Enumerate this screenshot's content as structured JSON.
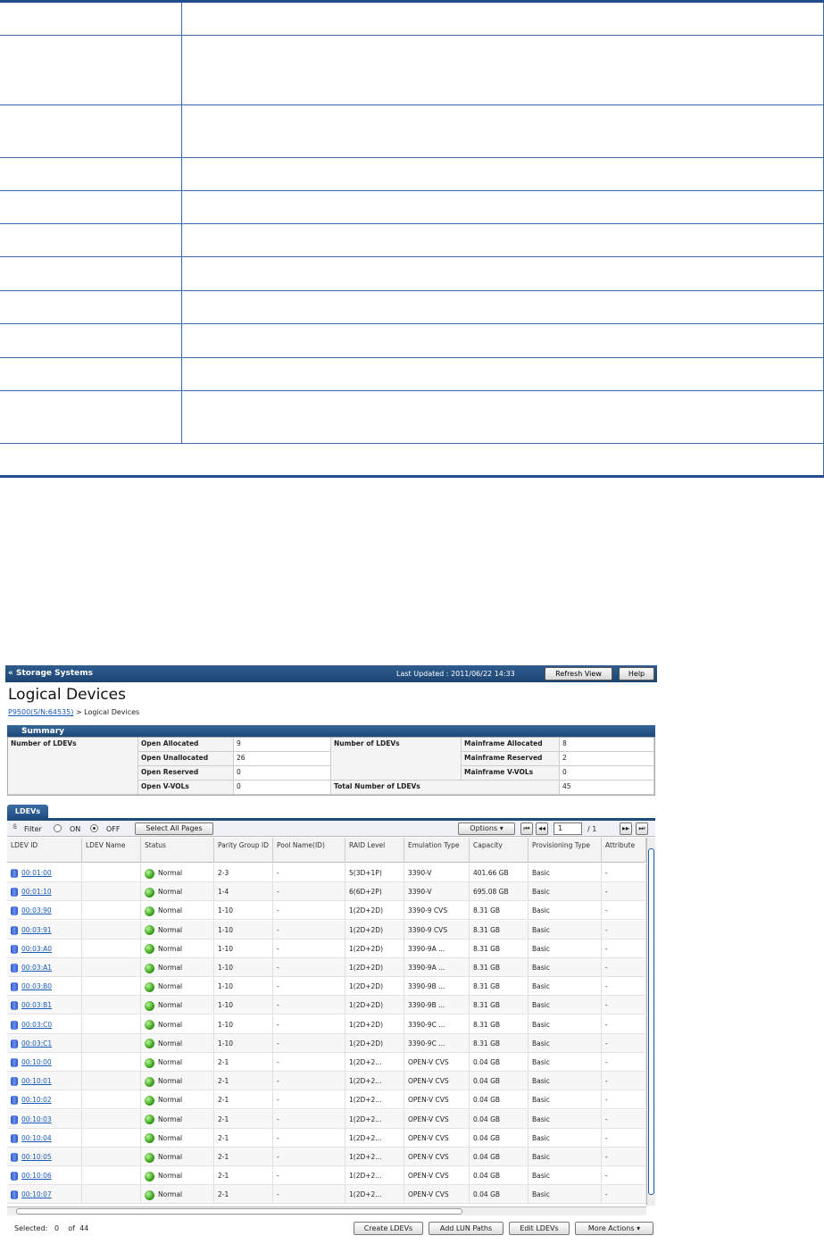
{
  "top_table": {
    "row_count": 12
  },
  "app": {
    "nav_title": "Storage Systems",
    "last_updated_label": "Last Updated : 2011/06/22 14:33",
    "refresh_button": "Refresh View",
    "help_button": "Help",
    "page_title": "Logical Devices",
    "breadcrumb_link": "P9500(S/N:64535)",
    "breadcrumb_current": "> Logical Devices"
  },
  "summary": {
    "title": "Summary",
    "open_label": "Number of LDEVs",
    "open_items": [
      {
        "label": "Open Allocated",
        "value": "9"
      },
      {
        "label": "Open Unallocated",
        "value": "26"
      },
      {
        "label": "Open Reserved",
        "value": "0"
      },
      {
        "label": "Open V-VOLs",
        "value": "0"
      }
    ],
    "mf_label": "Number of LDEVs",
    "mf_items": [
      {
        "label": "Mainframe Allocated",
        "value": "8"
      },
      {
        "label": "Mainframe Reserved",
        "value": "2"
      },
      {
        "label": "Mainframe V-VOLs",
        "value": "0"
      }
    ],
    "total_label": "Total Number of LDEVs",
    "total_value": "45"
  },
  "ldevs_tab": "LDEVs",
  "filter": {
    "label": "Filter",
    "on": "ON",
    "off": "OFF",
    "select_all": "Select All Pages",
    "options": "Options",
    "page": "1",
    "page_total": "/ 1"
  },
  "columns": [
    "LDEV ID",
    "LDEV Name",
    "Status",
    "Parity Group ID",
    "Pool Name(ID)",
    "RAID Level",
    "Emulation Type",
    "Capacity",
    "Provisioning Type",
    "Attribute"
  ],
  "rows": [
    [
      "00:01:00",
      "",
      "Normal",
      "2-3",
      "-",
      "5(3D+1P)",
      "3390-V",
      "401.66 GB",
      "Basic",
      "-"
    ],
    [
      "00:01:10",
      "",
      "Normal",
      "1-4",
      "-",
      "6(6D+2P)",
      "3390-V",
      "695.08 GB",
      "Basic",
      "-"
    ],
    [
      "00:03:90",
      "",
      "Normal",
      "1-10",
      "-",
      "1(2D+2D)",
      "3390-9 CVS",
      "8.31 GB",
      "Basic",
      "-"
    ],
    [
      "00:03:91",
      "",
      "Normal",
      "1-10",
      "-",
      "1(2D+2D)",
      "3390-9 CVS",
      "8.31 GB",
      "Basic",
      "-"
    ],
    [
      "00:03:A0",
      "",
      "Normal",
      "1-10",
      "-",
      "1(2D+2D)",
      "3390-9A ...",
      "8.31 GB",
      "Basic",
      "-"
    ],
    [
      "00:03:A1",
      "",
      "Normal",
      "1-10",
      "-",
      "1(2D+2D)",
      "3390-9A ...",
      "8.31 GB",
      "Basic",
      "-"
    ],
    [
      "00:03:B0",
      "",
      "Normal",
      "1-10",
      "-",
      "1(2D+2D)",
      "3390-9B ...",
      "8.31 GB",
      "Basic",
      "-"
    ],
    [
      "00:03:B1",
      "",
      "Normal",
      "1-10",
      "-",
      "1(2D+2D)",
      "3390-9B ...",
      "8.31 GB",
      "Basic",
      "-"
    ],
    [
      "00:03:C0",
      "",
      "Normal",
      "1-10",
      "-",
      "1(2D+2D)",
      "3390-9C ...",
      "8.31 GB",
      "Basic",
      "-"
    ],
    [
      "00:03:C1",
      "",
      "Normal",
      "1-10",
      "-",
      "1(2D+2D)",
      "3390-9C ...",
      "8.31 GB",
      "Basic",
      "-"
    ],
    [
      "00:10:00",
      "",
      "Normal",
      "2-1",
      "-",
      "1(2D+2...",
      "OPEN-V CVS",
      "0.04 GB",
      "Basic",
      "-"
    ],
    [
      "00:10:01",
      "",
      "Normal",
      "2-1",
      "-",
      "1(2D+2...",
      "OPEN-V CVS",
      "0.04 GB",
      "Basic",
      "-"
    ],
    [
      "00:10:02",
      "",
      "Normal",
      "2-1",
      "-",
      "1(2D+2...",
      "OPEN-V CVS",
      "0.04 GB",
      "Basic",
      "-"
    ],
    [
      "00:10:03",
      "",
      "Normal",
      "2-1",
      "-",
      "1(2D+2...",
      "OPEN-V CVS",
      "0.04 GB",
      "Basic",
      "-"
    ],
    [
      "00:10:04",
      "",
      "Normal",
      "2-1",
      "-",
      "1(2D+2...",
      "OPEN-V CVS",
      "0.04 GB",
      "Basic",
      "-"
    ],
    [
      "00:10:05",
      "",
      "Normal",
      "2-1",
      "-",
      "1(2D+2...",
      "OPEN-V CVS",
      "0.04 GB",
      "Basic",
      "-"
    ],
    [
      "00:10:06",
      "",
      "Normal",
      "2-1",
      "-",
      "1(2D+2...",
      "OPEN-V CVS",
      "0.04 GB",
      "Basic",
      "-"
    ],
    [
      "00:10:07",
      "",
      "Normal",
      "2-1",
      "-",
      "1(2D+2...",
      "OPEN-V CVS",
      "0.04 GB",
      "Basic",
      "-"
    ]
  ],
  "status": {
    "selected": "Selected:",
    "selected_count": "0",
    "of": "of",
    "total": "44"
  },
  "actions": {
    "create": "Create LDEVs",
    "add_lun": "Add LUN Paths",
    "edit": "Edit LDEVs",
    "more": "More Actions"
  }
}
